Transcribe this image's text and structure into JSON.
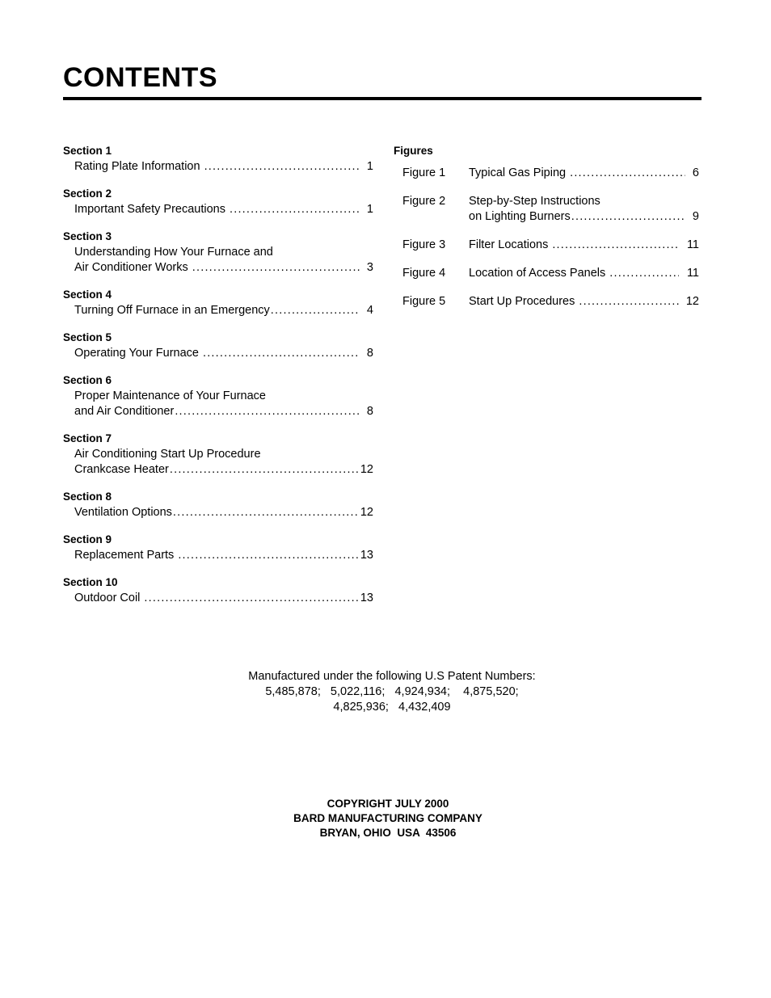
{
  "document": {
    "title": "CONTENTS"
  },
  "sections": {
    "items": [
      {
        "heading": "Section 1",
        "lines": [
          "Rating Plate Information"
        ],
        "page": "1",
        "gap_before_dots": true
      },
      {
        "heading": "Section 2",
        "lines": [
          "Important Safety Precautions"
        ],
        "page": "1",
        "gap_before_dots": true
      },
      {
        "heading": "Section 3",
        "lines": [
          "Understanding How Your Furnace and",
          "Air Conditioner Works"
        ],
        "page": "3",
        "gap_before_dots": true
      },
      {
        "heading": "Section 4",
        "lines": [
          "Turning Off Furnace in an Emergency"
        ],
        "page": "4",
        "gap_before_dots": false
      },
      {
        "heading": "Section 5",
        "lines": [
          "Operating Your Furnace"
        ],
        "page": "8",
        "gap_before_dots": true
      },
      {
        "heading": "Section 6",
        "lines": [
          "Proper Maintenance of Your Furnace",
          "and Air Conditioner"
        ],
        "page": "8",
        "gap_before_dots": false
      },
      {
        "heading": "Section 7",
        "lines": [
          "Air Conditioning Start Up Procedure",
          "Crankcase Heater"
        ],
        "page": "12",
        "gap_before_dots": false
      },
      {
        "heading": "Section 8",
        "lines": [
          "Ventilation Options"
        ],
        "page": "12",
        "gap_before_dots": false
      },
      {
        "heading": "Section 9",
        "lines": [
          "Replacement Parts"
        ],
        "page": "13",
        "gap_before_dots": true
      },
      {
        "heading": "Section 10",
        "lines": [
          "Outdoor Coil"
        ],
        "page": "13",
        "gap_before_dots": true
      }
    ]
  },
  "figures": {
    "heading": "Figures",
    "items": [
      {
        "label": "Figure 1",
        "lines": [
          "Typical Gas Piping"
        ],
        "page": "6",
        "gap_before_dots": true
      },
      {
        "label": "Figure 2",
        "lines": [
          "Step-by-Step Instructions",
          "on Lighting Burners"
        ],
        "page": "9",
        "gap_before_dots": false
      },
      {
        "label": "Figure 3",
        "lines": [
          "Filter Locations"
        ],
        "page": "11",
        "gap_before_dots": true
      },
      {
        "label": "Figure 4",
        "lines": [
          "Location of Access Panels"
        ],
        "page": "11",
        "gap_before_dots": true
      },
      {
        "label": "Figure 5",
        "lines": [
          "Start Up Procedures"
        ],
        "page": "12",
        "gap_before_dots": true
      }
    ]
  },
  "patent_notice": {
    "lines": [
      "Manufactured under the following U.S Patent Numbers:",
      "5,485,878;   5,022,116;   4,924,934;    4,875,520;",
      "4,825,936;   4,432,409"
    ]
  },
  "copyright": {
    "lines": [
      "COPYRIGHT JULY 2000",
      "BARD MANUFACTURING COMPANY",
      "BRYAN, OHIO  USA  43506"
    ]
  }
}
